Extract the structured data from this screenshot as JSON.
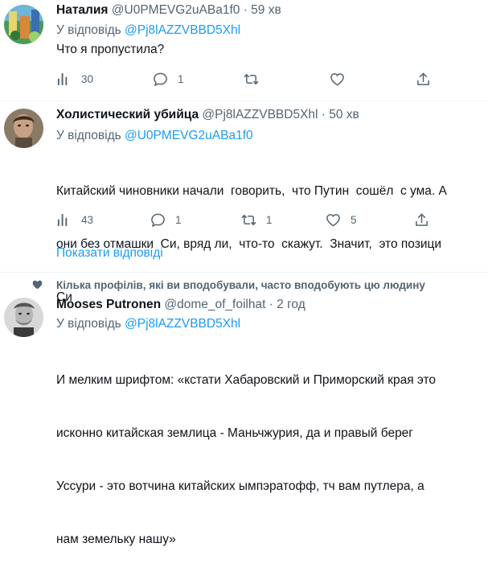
{
  "tweets": [
    {
      "name": "Наталия",
      "handle": "@U0PMEVG2uABa1f0",
      "time": "· 59 хв",
      "reply_prefix": "У відповідь",
      "reply_to": "@Pj8lAZZVBBD5Xhl",
      "text": "Что я пропустила?",
      "views": "30",
      "replies": "1",
      "retweets": "",
      "likes": ""
    },
    {
      "name": "Холистический убийца",
      "handle": "@Pj8lAZZVBBD5Xhl",
      "time": "· 50 хв",
      "reply_prefix": "У відповідь",
      "reply_to": "@U0PMEVG2uABa1f0",
      "text_lines": [
        "Китайский чиновники начали  говорить,  что Путин  сошёл  с ума. А",
        "они без отмашки  Си, вряд ли,  что-то  скажут.  Значит,  это позици",
        "Си"
      ],
      "views": "43",
      "replies": "1",
      "retweets": "1",
      "likes": "5"
    },
    {
      "social_context": "Кілька профілів, які ви вподобували, часто вподобують цю людину",
      "name": "Mooses Putronen",
      "handle": "@dome_of_foilhat",
      "time": "· 2 год",
      "reply_prefix": "У відповідь",
      "reply_to": "@Pj8lAZZVBBD5Xhl",
      "text_lines": [
        "И мелким шрифтом: «кстати Хабаровский и Приморский края это",
        "исконно китайская землица - Маньчжурия, да и правый берег",
        "Уссури - это вотчина китайских ымпэратофф, тч вам путлера, а",
        "нам земельку нашу»"
      ]
    }
  ],
  "show_replies_label": "Показати відповіді",
  "icons": [
    "views-icon",
    "reply-icon",
    "retweet-icon",
    "like-icon",
    "share-icon",
    "heart-small-icon"
  ],
  "colors": {
    "link": "#1d9bf0",
    "muted": "#536471",
    "text": "#0f1419"
  }
}
